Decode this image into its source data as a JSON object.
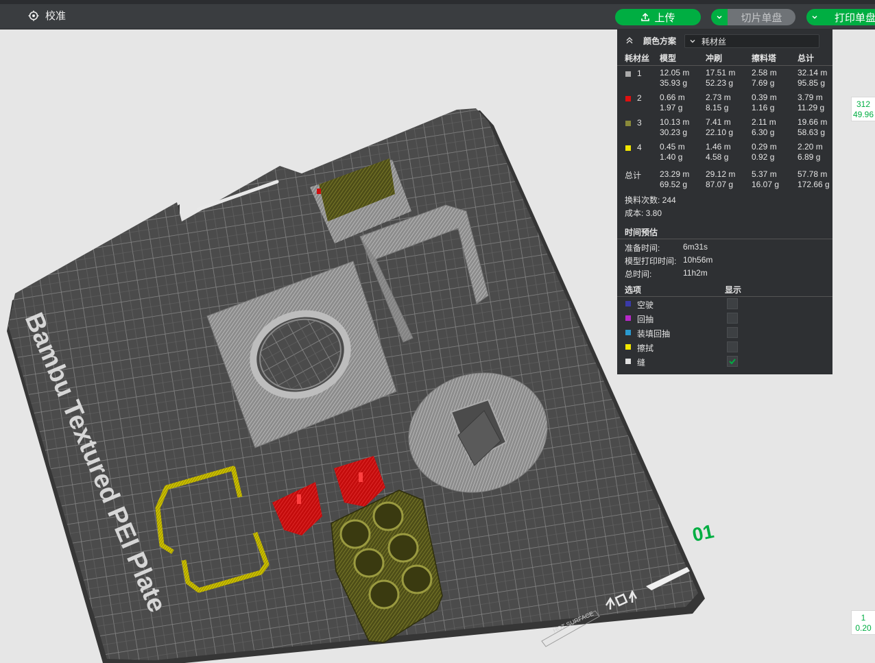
{
  "toolbar": {
    "calibrate_label": "校准",
    "upload_label": "上传",
    "slice_label": "切片单盘",
    "print_label": "打印单盘"
  },
  "panel": {
    "scheme_label": "颜色方案",
    "scheme_value": "耗材丝",
    "columns": [
      "耗材丝",
      "模型",
      "冲刷",
      "擦料塔",
      "总计"
    ],
    "rows": [
      {
        "index": "1",
        "color": "#aaaaaa",
        "model": [
          "12.05 m",
          "35.93 g"
        ],
        "flush": [
          "17.51 m",
          "52.23 g"
        ],
        "tower": [
          "2.58 m",
          "7.69 g"
        ],
        "total": [
          "32.14 m",
          "95.85 g"
        ]
      },
      {
        "index": "2",
        "color": "#e01010",
        "model": [
          "0.66 m",
          "1.97 g"
        ],
        "flush": [
          "2.73 m",
          "8.15 g"
        ],
        "tower": [
          "0.39 m",
          "1.16 g"
        ],
        "total": [
          "3.79 m",
          "11.29 g"
        ]
      },
      {
        "index": "3",
        "color": "#8a8a3a",
        "model": [
          "10.13 m",
          "30.23 g"
        ],
        "flush": [
          "7.41 m",
          "22.10 g"
        ],
        "tower": [
          "2.11 m",
          "6.30 g"
        ],
        "total": [
          "19.66 m",
          "58.63 g"
        ]
      },
      {
        "index": "4",
        "color": "#f2e600",
        "model": [
          "0.45 m",
          "1.40 g"
        ],
        "flush": [
          "1.46 m",
          "4.58 g"
        ],
        "tower": [
          "0.29 m",
          "0.92 g"
        ],
        "total": [
          "2.20 m",
          "6.89 g"
        ]
      }
    ],
    "sum_row": {
      "label": "总计",
      "model": [
        "23.29 m",
        "69.52 g"
      ],
      "flush": [
        "29.12 m",
        "87.07 g"
      ],
      "tower": [
        "5.37 m",
        "16.07 g"
      ],
      "total": [
        "57.78 m",
        "172.66 g"
      ]
    },
    "swaps": "换料次数:  244",
    "cost": "成本:  3.80",
    "time_title": "时间预估",
    "prep_label": "准备时间:",
    "prep_value": "6m31s",
    "model_time_label": "模型打印时间:",
    "model_time_value": "10h56m",
    "total_time_label": "总时间:",
    "total_time_value": "11h2m",
    "options_title": "选项",
    "display_title": "显示",
    "options": [
      {
        "label": "空驶",
        "color": "#3a3aa8",
        "checked": false
      },
      {
        "label": "回抽",
        "color": "#b828c8",
        "checked": false
      },
      {
        "label": "装填回抽",
        "color": "#2a9ad0",
        "checked": false
      },
      {
        "label": "擦拭",
        "color": "#f2e600",
        "checked": false
      },
      {
        "label": "缝",
        "color": "#e0e0e0",
        "checked": true
      }
    ]
  },
  "plate": {
    "brand_text": "Bambu Textured PEI Plate",
    "plate_number": "01",
    "hot_surface": "HOT SURFACE"
  },
  "rulers": {
    "top": [
      "312",
      "49.96"
    ],
    "bottom": [
      "1",
      "0.20"
    ]
  },
  "colors": {
    "accent": "#00ae42",
    "panel_bg": "#2e3033",
    "bed": "#4a4a4a",
    "model_gray": "#9a9a9a",
    "model_red": "#d41010",
    "model_olive": "#5f5f1e",
    "model_yellow": "#e6dc00"
  }
}
